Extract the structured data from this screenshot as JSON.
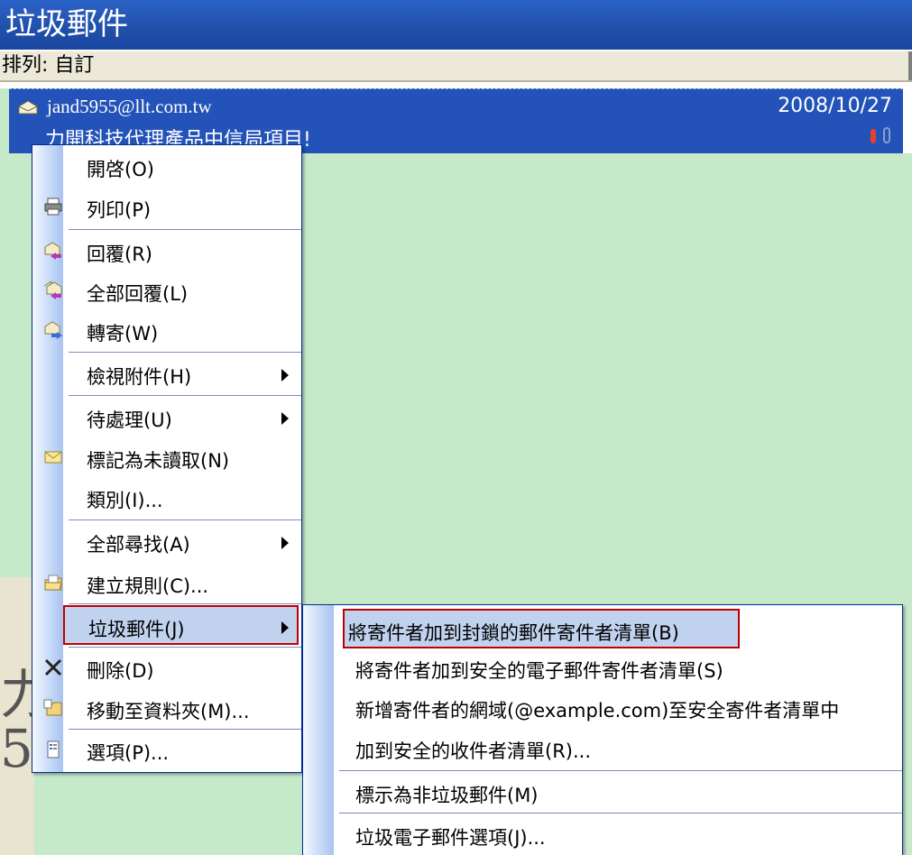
{
  "folder_title": "垃圾郵件",
  "sort_label": "排列: 自訂",
  "message": {
    "sender": "jand5955@llt.com.tw",
    "date": "2008/10/27",
    "subject": "力開科技代理產品中信局項目!",
    "icon": "envelope-open-icon"
  },
  "context_menu": {
    "items": [
      {
        "label": "開啓(O)",
        "icon": "",
        "submenu": false
      },
      {
        "label": "列印(P)",
        "icon": "printer-icon",
        "submenu": false
      },
      {
        "label": "回覆(R)",
        "icon": "reply-icon",
        "submenu": false
      },
      {
        "label": "全部回覆(L)",
        "icon": "reply-all-icon",
        "submenu": false
      },
      {
        "label": "轉寄(W)",
        "icon": "forward-icon",
        "submenu": false
      },
      {
        "label": "檢視附件(H)",
        "icon": "",
        "submenu": true
      },
      {
        "label": "待處理(U)",
        "icon": "",
        "submenu": true
      },
      {
        "label": "標記為未讀取(N)",
        "icon": "envelope-icon",
        "submenu": false
      },
      {
        "label": "類別(I)...",
        "icon": "",
        "submenu": false
      },
      {
        "label": "全部尋找(A)",
        "icon": "",
        "submenu": true
      },
      {
        "label": "建立規則(C)...",
        "icon": "rules-icon",
        "submenu": false
      },
      {
        "label": "垃圾郵件(J)",
        "icon": "",
        "submenu": true,
        "highlighted": true
      },
      {
        "label": "刪除(D)",
        "icon": "delete-x-icon",
        "submenu": false
      },
      {
        "label": "移動至資料夾(M)...",
        "icon": "move-folder-icon",
        "submenu": false
      },
      {
        "label": "選項(P)...",
        "icon": "options-icon",
        "submenu": false
      }
    ]
  },
  "junk_submenu": {
    "items": [
      {
        "label": "將寄件者加到封鎖的郵件寄件者清單(B)",
        "highlighted": true
      },
      {
        "label": "將寄件者加到安全的電子郵件寄件者清單(S)"
      },
      {
        "label": "新增寄件者的網域(@example.com)至安全寄件者清單中"
      },
      {
        "label": "加到安全的收件者清單(R)..."
      },
      {
        "label": "標示為非垃圾郵件(M)"
      },
      {
        "label": "垃圾電子郵件選項(J)..."
      }
    ]
  },
  "colors": {
    "title_bar": "#1f4fa8",
    "selected_row": "#2353b8",
    "background": "#c5e9c9",
    "highlight_border": "#c00000"
  }
}
